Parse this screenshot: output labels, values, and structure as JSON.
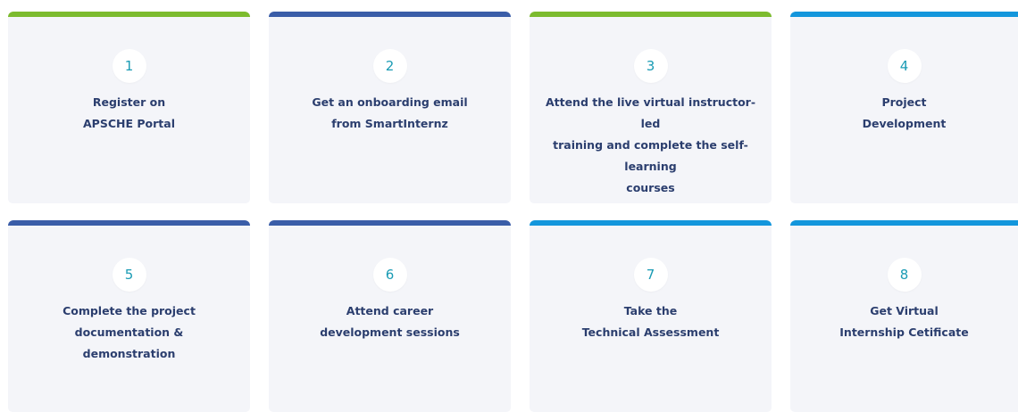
{
  "colors": {
    "green": "#7cbb2e",
    "navy": "#3a5da8",
    "sky": "#1396dc",
    "card_bg": "#f4f5f9",
    "step_number": "#1a9bb4",
    "step_text": "#2b3e6e"
  },
  "steps": [
    {
      "number": "1",
      "text": "Register on\nAPSCHE Portal",
      "accent": "#7cbb2e"
    },
    {
      "number": "2",
      "text": "Get an onboarding email\nfrom SmartInternz",
      "accent": "#3a5da8"
    },
    {
      "number": "3",
      "text": "Attend the live virtual instructor-led\ntraining and complete the self-learning\ncourses",
      "accent": "#7cbb2e"
    },
    {
      "number": "4",
      "text": "Project\nDevelopment",
      "accent": "#1396dc"
    },
    {
      "number": "5",
      "text": "Complete the project documentation &\ndemonstration",
      "accent": "#3a5da8"
    },
    {
      "number": "6",
      "text": "Attend career\ndevelopment sessions",
      "accent": "#3a5da8"
    },
    {
      "number": "7",
      "text": "Take the\nTechnical Assessment",
      "accent": "#1396dc"
    },
    {
      "number": "8",
      "text": "Get Virtual\nInternship Cetificate",
      "accent": "#1396dc"
    }
  ]
}
